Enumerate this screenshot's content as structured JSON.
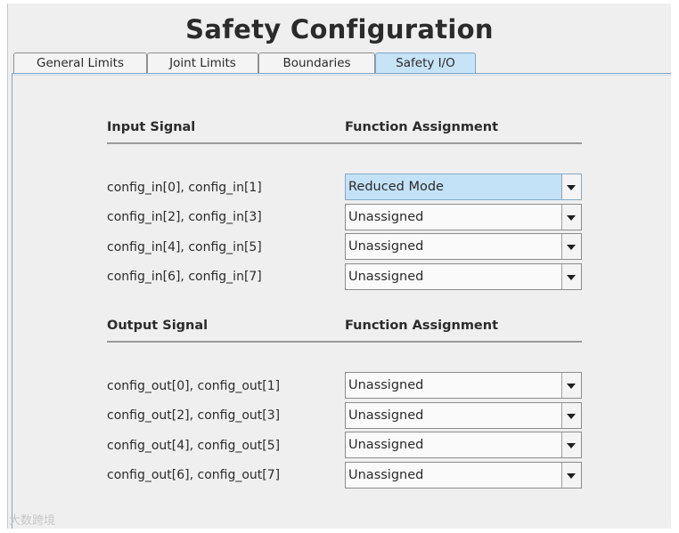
{
  "window": {
    "title": "Safety Configuration"
  },
  "tabs": [
    {
      "label": "General Limits",
      "active": false
    },
    {
      "label": "Joint Limits",
      "active": false
    },
    {
      "label": "Boundaries",
      "active": false
    },
    {
      "label": "Safety I/O",
      "active": true
    }
  ],
  "input_section": {
    "signal_header": "Input Signal",
    "function_header": "Function Assignment",
    "rows": [
      {
        "signal": "config_in[0], config_in[1]",
        "assignment": "Reduced Mode",
        "selected": true
      },
      {
        "signal": "config_in[2], config_in[3]",
        "assignment": "Unassigned",
        "selected": false
      },
      {
        "signal": "config_in[4], config_in[5]",
        "assignment": "Unassigned",
        "selected": false
      },
      {
        "signal": "config_in[6], config_in[7]",
        "assignment": "Unassigned",
        "selected": false
      }
    ]
  },
  "output_section": {
    "signal_header": "Output Signal",
    "function_header": "Function Assignment",
    "rows": [
      {
        "signal": "config_out[0], config_out[1]",
        "assignment": "Unassigned",
        "selected": false
      },
      {
        "signal": "config_out[2], config_out[3]",
        "assignment": "Unassigned",
        "selected": false
      },
      {
        "signal": "config_out[4], config_out[5]",
        "assignment": "Unassigned",
        "selected": false
      },
      {
        "signal": "config_out[6], config_out[7]",
        "assignment": "Unassigned",
        "selected": false
      }
    ]
  },
  "watermark": {
    "text": "大数跨境"
  },
  "colors": {
    "active_tab": "#c7e3f6",
    "selected_combo": "#c4e2f7",
    "panel_background": "#efefef"
  },
  "icons": {
    "dropdown": "chevron-down-icon"
  }
}
